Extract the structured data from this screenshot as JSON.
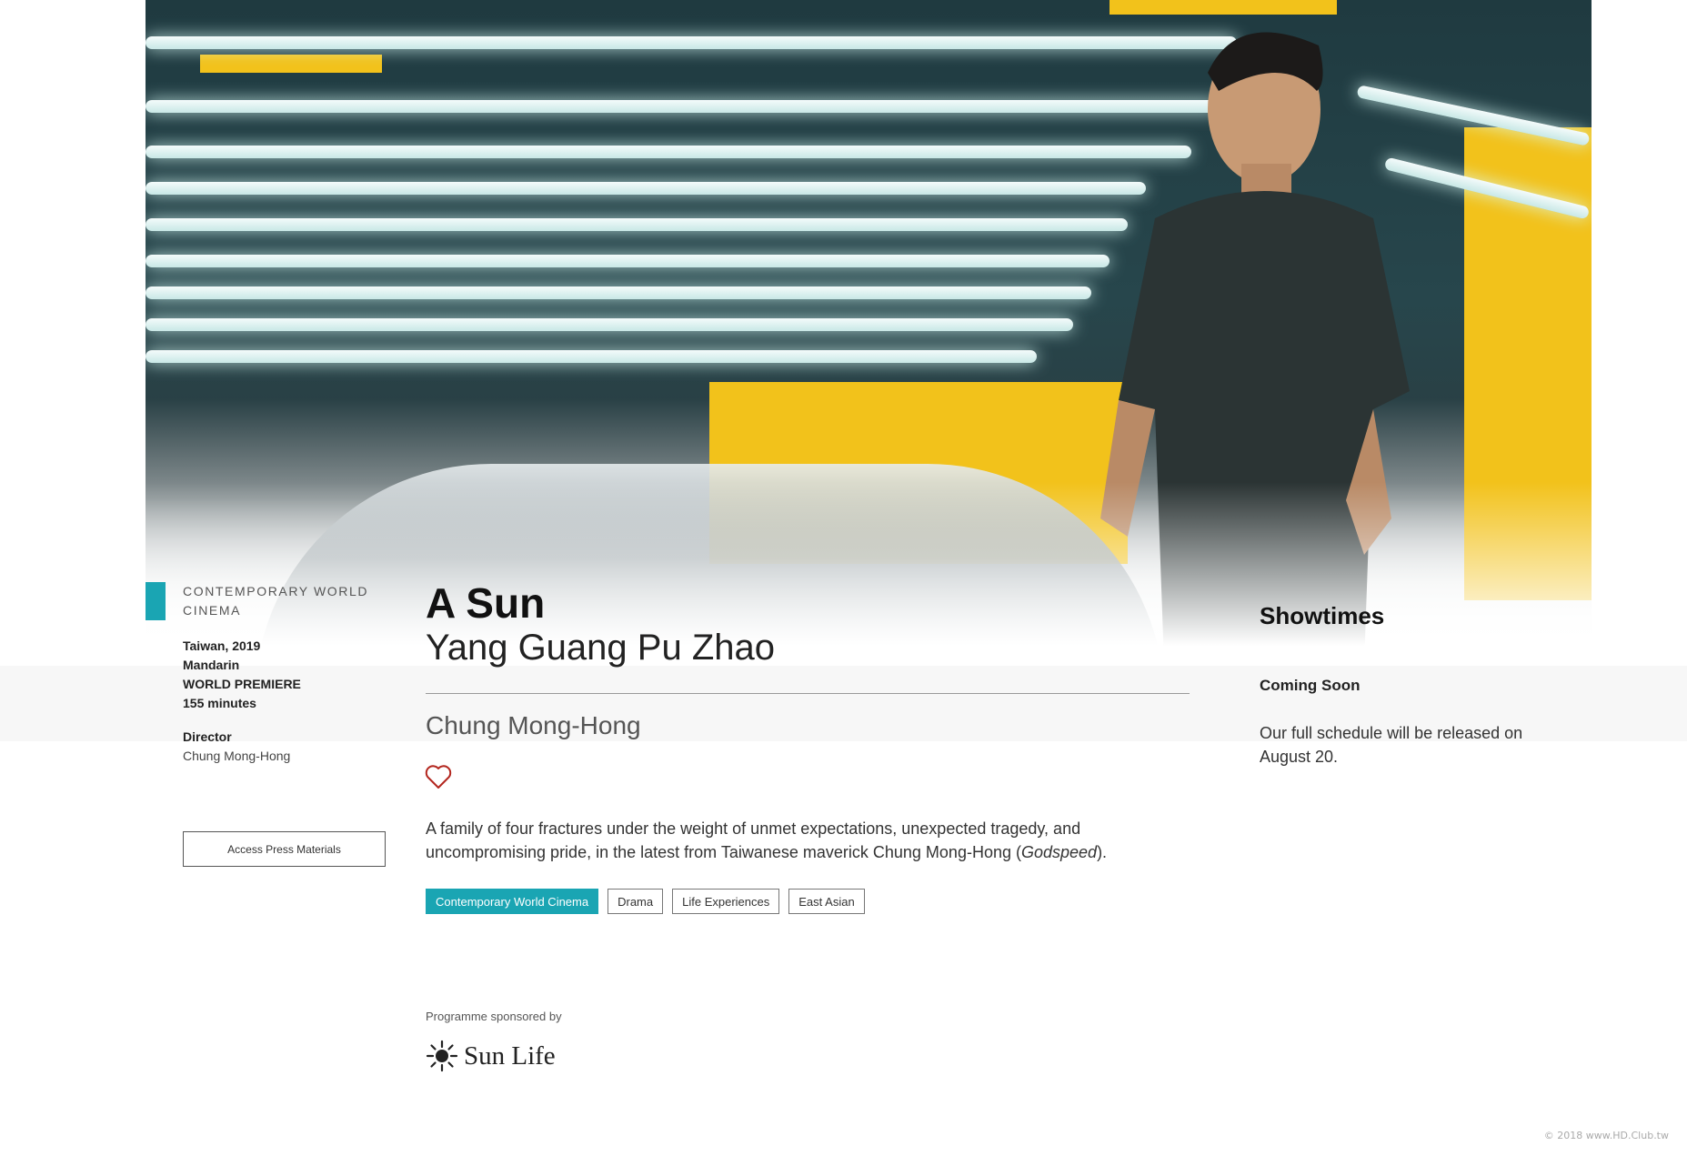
{
  "film": {
    "program": "Contemporary World Cinema",
    "country_year": "Taiwan, 2019",
    "language": "Mandarin",
    "premiere": "WORLD PREMIERE",
    "runtime": "155 minutes",
    "director_label": "Director",
    "director": "Chung Mong-Hong",
    "title": "A Sun",
    "original_title": "Yang Guang Pu Zhao",
    "synopsis_before": "A family of four fractures under the weight of unmet expectations, unexpected tragedy, and uncompromising pride, in the latest from Taiwanese maverick Chung Mong-Hong (",
    "synopsis_italic": "Godspeed",
    "synopsis_after": ")."
  },
  "actions": {
    "press_button": "Access Press Materials",
    "favourite_icon": "heart-icon"
  },
  "tags": [
    {
      "label": "Contemporary World Cinema"
    },
    {
      "label": "Drama"
    },
    {
      "label": "Life Experiences"
    },
    {
      "label": "East Asian"
    }
  ],
  "sponsor": {
    "label": "Programme sponsored by",
    "name": "Sun Life"
  },
  "showtimes": {
    "title": "Showtimes",
    "status": "Coming Soon",
    "note": "Our full schedule will be released on August 20."
  },
  "watermark": "© 2018 www.HD.Club.tw",
  "colors": {
    "accent": "#1aa5b3",
    "heart": "#c0392b"
  }
}
